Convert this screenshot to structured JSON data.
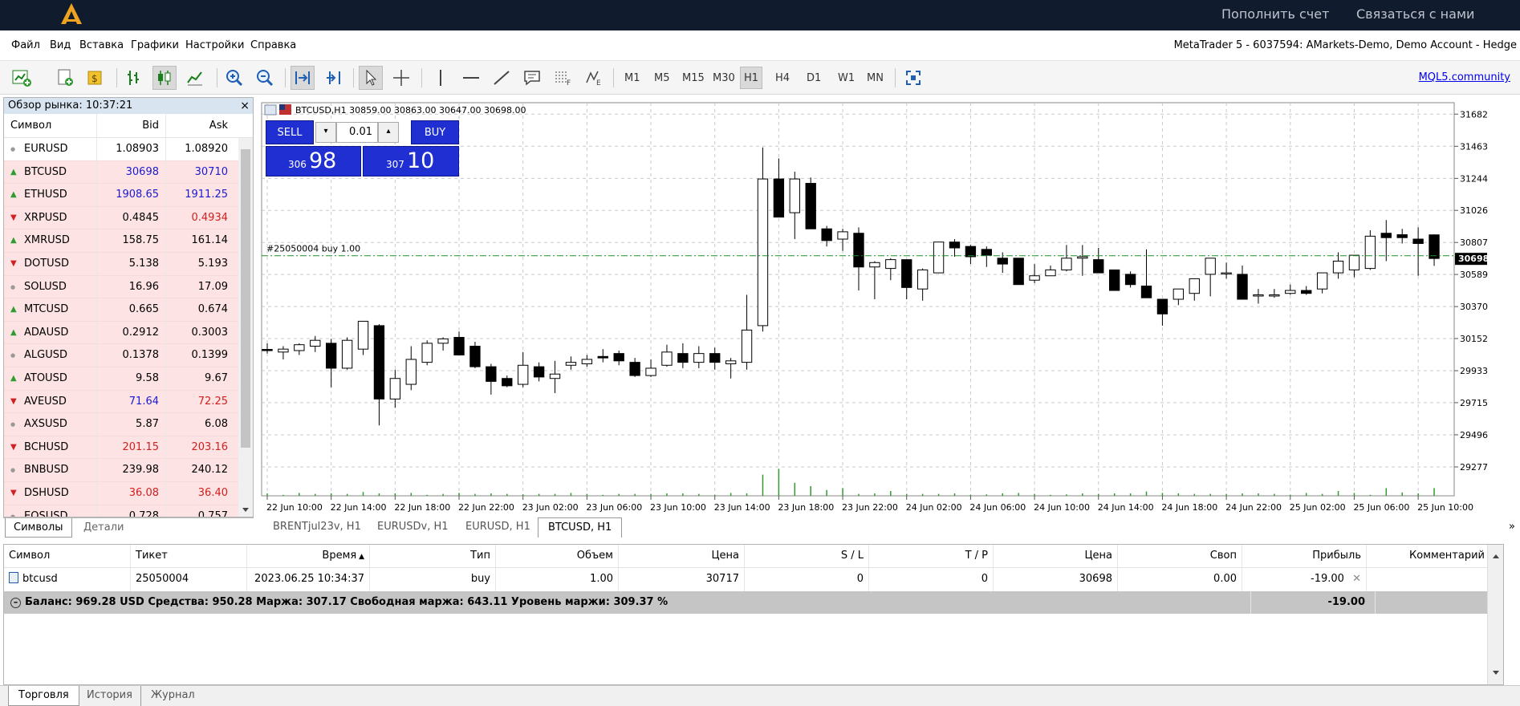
{
  "topbar": {
    "deposit": "Пополнить счет",
    "contact": "Связаться с нами"
  },
  "menu": [
    "Файл",
    "Вид",
    "Вставка",
    "Графики",
    "Настройки",
    "Справка"
  ],
  "window_title": "MetaTrader 5 - 6037594: AMarkets-Demo, Demo Account - Hedge",
  "timeframes": [
    "M1",
    "M5",
    "M15",
    "M30",
    "H1",
    "H4",
    "D1",
    "W1",
    "MN"
  ],
  "active_timeframe": "H1",
  "mql5": "MQL5.community",
  "market_watch": {
    "title": "Обзор рынка: 10:37:21",
    "col_symbol": "Символ",
    "col_bid": "Bid",
    "col_ask": "Ask",
    "rows": [
      {
        "symbol": "EURUSD",
        "bid": "1.08903",
        "ask": "1.08920",
        "dir": "none",
        "bid_color": "#000000",
        "ask_color": "#000000"
      },
      {
        "symbol": "BTCUSD",
        "bid": "30698",
        "ask": "30710",
        "dir": "up",
        "bid_color": "#1a1ad0",
        "ask_color": "#1a1ad0"
      },
      {
        "symbol": "ETHUSD",
        "bid": "1908.65",
        "ask": "1911.25",
        "dir": "up",
        "bid_color": "#1a1ad0",
        "ask_color": "#1a1ad0"
      },
      {
        "symbol": "XRPUSD",
        "bid": "0.4845",
        "ask": "0.4934",
        "dir": "down",
        "bid_color": "#000000",
        "ask_color": "#d02020"
      },
      {
        "symbol": "XMRUSD",
        "bid": "158.75",
        "ask": "161.14",
        "dir": "up",
        "bid_color": "#000000",
        "ask_color": "#000000"
      },
      {
        "symbol": "DOTUSD",
        "bid": "5.138",
        "ask": "5.193",
        "dir": "down",
        "bid_color": "#000000",
        "ask_color": "#000000"
      },
      {
        "symbol": "SOLUSD",
        "bid": "16.96",
        "ask": "17.09",
        "dir": "none",
        "bid_color": "#000000",
        "ask_color": "#000000"
      },
      {
        "symbol": "MTCUSD",
        "bid": "0.665",
        "ask": "0.674",
        "dir": "up",
        "bid_color": "#000000",
        "ask_color": "#000000"
      },
      {
        "symbol": "ADAUSD",
        "bid": "0.2912",
        "ask": "0.3003",
        "dir": "up",
        "bid_color": "#000000",
        "ask_color": "#000000"
      },
      {
        "symbol": "ALGUSD",
        "bid": "0.1378",
        "ask": "0.1399",
        "dir": "none",
        "bid_color": "#000000",
        "ask_color": "#000000"
      },
      {
        "symbol": "ATOUSD",
        "bid": "9.58",
        "ask": "9.67",
        "dir": "up",
        "bid_color": "#000000",
        "ask_color": "#000000"
      },
      {
        "symbol": "AVEUSD",
        "bid": "71.64",
        "ask": "72.25",
        "dir": "down",
        "bid_color": "#1a1ad0",
        "ask_color": "#d02020"
      },
      {
        "symbol": "AXSUSD",
        "bid": "5.87",
        "ask": "6.08",
        "dir": "none",
        "bid_color": "#000000",
        "ask_color": "#000000"
      },
      {
        "symbol": "BCHUSD",
        "bid": "201.15",
        "ask": "203.16",
        "dir": "down",
        "bid_color": "#d02020",
        "ask_color": "#d02020"
      },
      {
        "symbol": "BNBUSD",
        "bid": "239.98",
        "ask": "240.12",
        "dir": "none",
        "bid_color": "#000000",
        "ask_color": "#000000"
      },
      {
        "symbol": "DSHUSD",
        "bid": "36.08",
        "ask": "36.40",
        "dir": "down",
        "bid_color": "#d02020",
        "ask_color": "#d02020"
      },
      {
        "symbol": "EOSUSD",
        "bid": "0.728",
        "ask": "0.757",
        "dir": "none",
        "bid_color": "#000000",
        "ask_color": "#000000"
      }
    ],
    "tabs": [
      "Символы",
      "Детали"
    ]
  },
  "chart_tabs": [
    "BRENTjul23v, H1",
    "EURUSDv, H1",
    "EURUSD, H1",
    "BTCUSD, H1"
  ],
  "active_chart_tab": "BTCUSD, H1",
  "trade_panel": {
    "sell": "SELL",
    "buy": "BUY",
    "volume": "0.01",
    "sell_small": "306",
    "sell_big": "98",
    "buy_small": "307",
    "buy_big": "10"
  },
  "chart_data": {
    "type": "candlestick",
    "title": "BTCUSD,H1  30859.00 30863.00 30647.00 30698.00",
    "position_label": "#25050004 buy 1.00",
    "position_price": 30717,
    "current_price_label": "30698",
    "current_price": 30698,
    "ylim": [
      29080,
      31760
    ],
    "y_ticks": [
      "31682",
      "31463",
      "31244",
      "31026",
      "30807",
      "30589",
      "30370",
      "30152",
      "29933",
      "29715",
      "29496",
      "29277"
    ],
    "x_ticks": [
      "22 Jun 10:00",
      "22 Jun 14:00",
      "22 Jun 18:00",
      "22 Jun 22:00",
      "23 Jun 02:00",
      "23 Jun 06:00",
      "23 Jun 10:00",
      "23 Jun 14:00",
      "23 Jun 18:00",
      "23 Jun 22:00",
      "24 Jun 02:00",
      "24 Jun 06:00",
      "24 Jun 10:00",
      "24 Jun 14:00",
      "24 Jun 18:00",
      "24 Jun 22:00",
      "25 Jun 02:00",
      "25 Jun 06:00",
      "25 Jun 10:00"
    ],
    "candles": [
      [
        30078,
        30120,
        30050,
        30070
      ],
      [
        30060,
        30100,
        30010,
        30080
      ],
      [
        30070,
        30120,
        30040,
        30110
      ],
      [
        30100,
        30170,
        30060,
        30140
      ],
      [
        30120,
        30150,
        29820,
        29950
      ],
      [
        29950,
        30160,
        29940,
        30140
      ],
      [
        30080,
        30260,
        30040,
        30270
      ],
      [
        30240,
        30250,
        29560,
        29740
      ],
      [
        29740,
        29940,
        29680,
        29880
      ],
      [
        29840,
        30100,
        29800,
        30010
      ],
      [
        29990,
        30140,
        29970,
        30120
      ],
      [
        30120,
        30160,
        30070,
        30150
      ],
      [
        30160,
        30200,
        30040,
        30040
      ],
      [
        30100,
        30130,
        29950,
        29960
      ],
      [
        29960,
        29980,
        29770,
        29860
      ],
      [
        29880,
        29900,
        29820,
        29830
      ],
      [
        29840,
        30060,
        29820,
        29970
      ],
      [
        29960,
        29990,
        29860,
        29890
      ],
      [
        29880,
        30000,
        29780,
        29910
      ],
      [
        29970,
        30030,
        29940,
        29990
      ],
      [
        29980,
        30040,
        29960,
        30010
      ],
      [
        30030,
        30080,
        29990,
        30020
      ],
      [
        30050,
        30070,
        29970,
        30000
      ],
      [
        29990,
        30020,
        29890,
        29900
      ],
      [
        29900,
        30010,
        29890,
        29950
      ],
      [
        29970,
        30110,
        29960,
        30060
      ],
      [
        30050,
        30120,
        29950,
        29990
      ],
      [
        29990,
        30100,
        29950,
        30050
      ],
      [
        30050,
        30090,
        29940,
        29990
      ],
      [
        29980,
        30020,
        29880,
        30000
      ],
      [
        29990,
        30450,
        29940,
        30210
      ],
      [
        30240,
        31455,
        30200,
        31240
      ],
      [
        31240,
        31380,
        30990,
        30980
      ],
      [
        31010,
        31290,
        30830,
        31240
      ],
      [
        31210,
        31250,
        30900,
        30900
      ],
      [
        30900,
        30920,
        30780,
        30820
      ],
      [
        30830,
        30900,
        30750,
        30880
      ],
      [
        30870,
        30910,
        30480,
        30640
      ],
      [
        30640,
        30680,
        30420,
        30670
      ],
      [
        30630,
        30700,
        30550,
        30690
      ],
      [
        30690,
        30690,
        30420,
        30500
      ],
      [
        30490,
        30630,
        30410,
        30620
      ],
      [
        30600,
        30810,
        30600,
        30810
      ],
      [
        30810,
        30830,
        30710,
        30770
      ],
      [
        30780,
        30790,
        30660,
        30710
      ],
      [
        30760,
        30780,
        30640,
        30720
      ],
      [
        30700,
        30740,
        30600,
        30660
      ],
      [
        30700,
        30700,
        30580,
        30520
      ],
      [
        30550,
        30660,
        30530,
        30580
      ],
      [
        30580,
        30650,
        30580,
        30620
      ],
      [
        30620,
        30790,
        30610,
        30700
      ],
      [
        30700,
        30790,
        30580,
        30710
      ],
      [
        30690,
        30770,
        30630,
        30600
      ],
      [
        30620,
        30620,
        30590,
        30480
      ],
      [
        30590,
        30610,
        30500,
        30520
      ],
      [
        30510,
        30760,
        30490,
        30430
      ],
      [
        30420,
        30410,
        30240,
        30320
      ],
      [
        30420,
        30480,
        30380,
        30490
      ],
      [
        30460,
        30560,
        30410,
        30560
      ],
      [
        30590,
        30700,
        30440,
        30700
      ],
      [
        30600,
        30670,
        30560,
        30600
      ],
      [
        30590,
        30650,
        30510,
        30420
      ],
      [
        30450,
        30490,
        30390,
        30450
      ],
      [
        30450,
        30490,
        30430,
        30450
      ],
      [
        30460,
        30520,
        30450,
        30480
      ],
      [
        30480,
        30510,
        30450,
        30460
      ],
      [
        30490,
        30590,
        30460,
        30600
      ],
      [
        30600,
        30740,
        30560,
        30680
      ],
      [
        30620,
        30720,
        30570,
        30720
      ],
      [
        30630,
        30890,
        30620,
        30850
      ],
      [
        30870,
        30960,
        30680,
        30840
      ],
      [
        30860,
        30900,
        30800,
        30840
      ],
      [
        30830,
        30910,
        30580,
        30800
      ],
      [
        30859,
        30863,
        30647,
        30698
      ]
    ],
    "volume_fraction": [
      0.05,
      0.02,
      0.06,
      0.04,
      0.05,
      0.04,
      0.08,
      0.05,
      0.05,
      0.06,
      0.02,
      0.04,
      0.06,
      0.04,
      0.05,
      0.04,
      0.03,
      0.04,
      0.04,
      0.06,
      0.04,
      0.02,
      0.04,
      0.04,
      0.04,
      0.05,
      0.05,
      0.04,
      0.02,
      0.06,
      0.05,
      0.44,
      0.56,
      0.27,
      0.2,
      0.12,
      0.16,
      0.04,
      0.05,
      0.1,
      0.04,
      0.04,
      0.04,
      0.05,
      0.02,
      0.03,
      0.05,
      0.06,
      0.04,
      0.02,
      0.03,
      0.05,
      0.04,
      0.05,
      0.05,
      0.09,
      0.06,
      0.05,
      0.04,
      0.04,
      0.04,
      0.05,
      0.05,
      0.04,
      0.02,
      0.06,
      0.04,
      0.1,
      0.06,
      0.02,
      0.16,
      0.07,
      0.05,
      0.16
    ]
  },
  "toolbox": {
    "columns": [
      "Символ",
      "Тикет",
      "Время",
      "Тип",
      "Объем",
      "Цена",
      "S / L",
      "T / P",
      "Цена",
      "Своп",
      "Прибыль",
      "Комментарий"
    ],
    "row": [
      "btcusd",
      "25050004",
      "2023.06.25 10:34:37",
      "buy",
      "1.00",
      "30717",
      "0",
      "0",
      "30698",
      "0.00",
      "-19.00",
      ""
    ],
    "balance_text": "Баланс: 969.28 USD  Средства: 950.28  Маржа: 307.17  Свободная маржа: 643.11  Уровень маржи: 309.37 %",
    "balance_profit": "-19.00"
  },
  "bottom_tabs": [
    "Торговля",
    "История",
    "Журнал"
  ]
}
